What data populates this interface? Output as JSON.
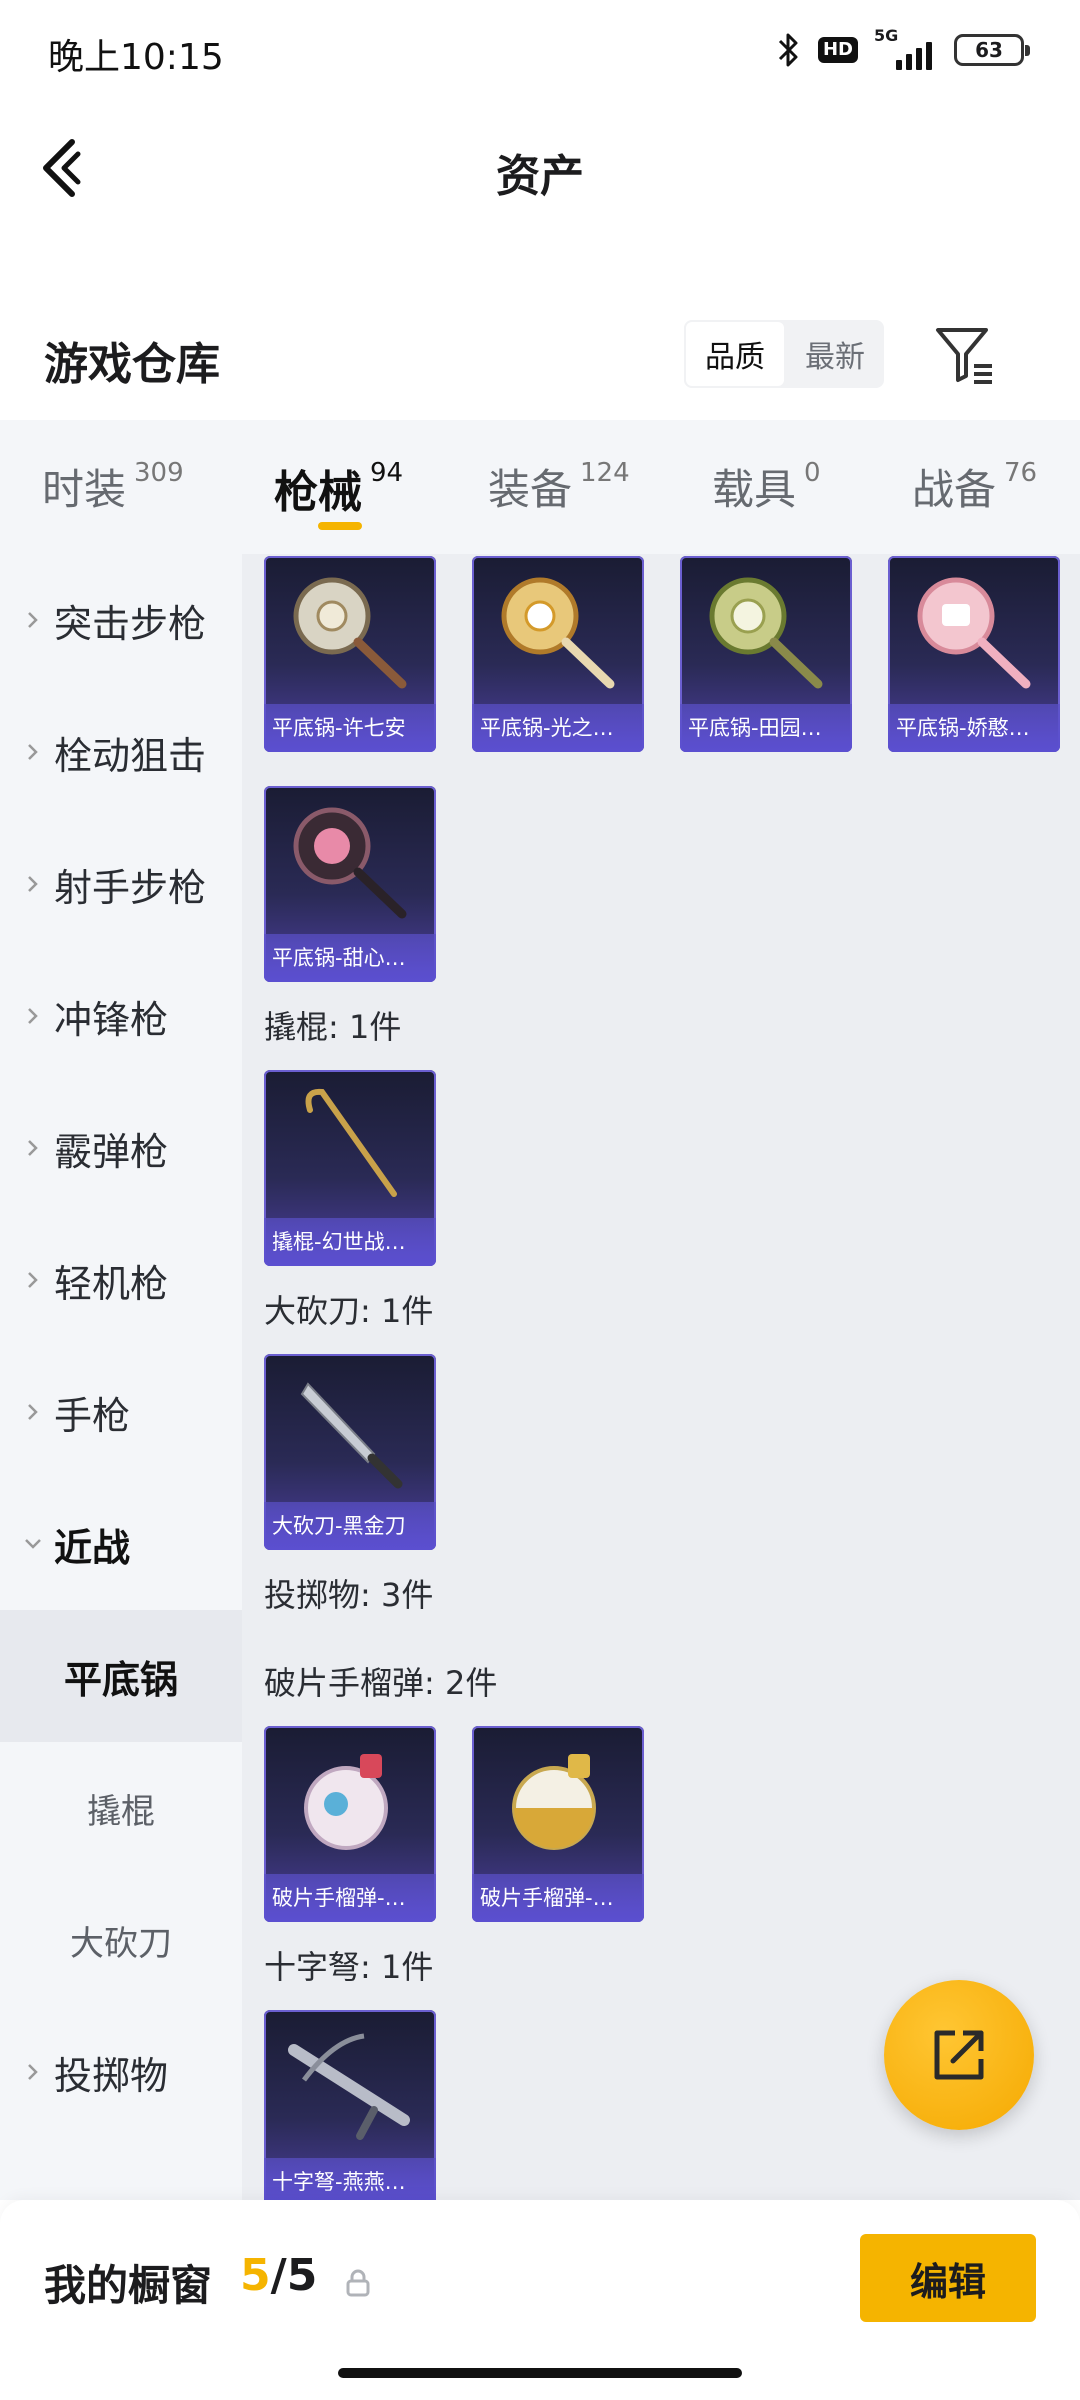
{
  "status_bar": {
    "time": "晚上10:15",
    "hd": "HD",
    "network": "5G",
    "battery": "63"
  },
  "header": {
    "title": "资产"
  },
  "section": {
    "title": "游戏仓库",
    "sort_options": [
      "品质",
      "最新"
    ],
    "sort_selected": "品质"
  },
  "tabs": [
    {
      "label": "时装",
      "count": "309"
    },
    {
      "label": "枪械",
      "count": "94",
      "active": true
    },
    {
      "label": "装备",
      "count": "124"
    },
    {
      "label": "载具",
      "count": "0"
    },
    {
      "label": "战备",
      "count": "76"
    }
  ],
  "sidebar": {
    "categories": [
      "突击步枪",
      "栓动狙击",
      "射手步枪",
      "冲锋枪",
      "霰弹枪",
      "轻机枪",
      "手枪",
      "近战"
    ],
    "subcategories": [
      "平底锅",
      "撬棍",
      "大砍刀"
    ],
    "after": [
      "投掷物"
    ],
    "active_subcategory": "平底锅"
  },
  "content": {
    "pan_items": [
      "平底锅-许七安",
      "平底锅-光之…",
      "平底锅-田园…",
      "平底锅-娇憨…",
      "平底锅-甜心…"
    ],
    "crowbar_title": "撬棍: 1件",
    "crowbar_items": [
      "撬棍-幻世战…"
    ],
    "machete_title": "大砍刀: 1件",
    "machete_items": [
      "大砍刀-黑金刀"
    ],
    "throwable_title": "投掷物: 3件",
    "grenade_title": "破片手榴弹: 2件",
    "grenade_items": [
      "破片手榴弹-…",
      "破片手榴弹-…"
    ],
    "crossbow_title": "十字弩: 1件",
    "crossbow_items": [
      "十字弩-燕燕…"
    ]
  },
  "bottom_bar": {
    "label": "我的橱窗",
    "count_current": "5",
    "count_separator": "/",
    "count_max": "5",
    "edit_label": "编辑"
  },
  "colors": {
    "accent": "#f5b400",
    "card_gradient_bottom": "#5b4fd0"
  }
}
